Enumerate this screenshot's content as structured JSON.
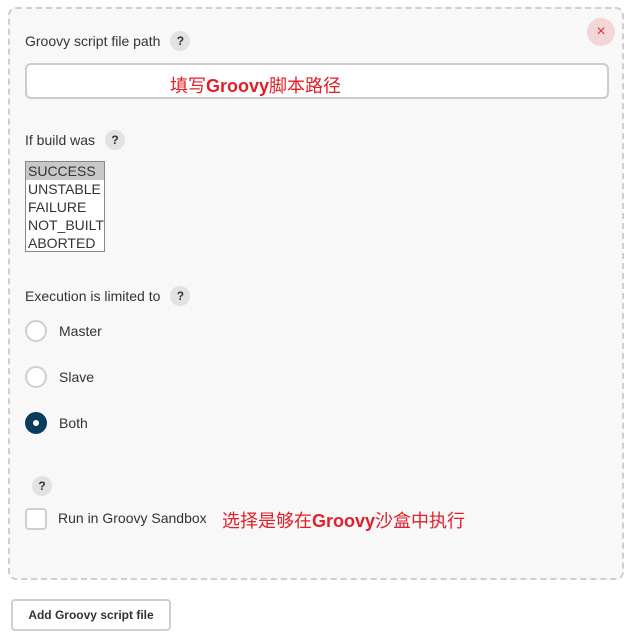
{
  "panel": {
    "close_glyph": "×",
    "script_path": {
      "label": "Groovy script file path",
      "help": "?",
      "value": "",
      "annotation_prefix": "填写",
      "annotation_bold": "Groovy",
      "annotation_suffix": "脚本路径"
    },
    "build_result": {
      "label": "If build was",
      "help": "?",
      "options": [
        "SUCCESS",
        "UNSTABLE",
        "FAILURE",
        "NOT_BUILT",
        "ABORTED"
      ],
      "selected": "SUCCESS"
    },
    "execution": {
      "label": "Execution is limited to",
      "help": "?",
      "options": [
        "Master",
        "Slave",
        "Both"
      ],
      "selected": "Both"
    },
    "sandbox": {
      "help": "?",
      "label": "Run in Groovy Sandbox",
      "checked": false,
      "annotation_prefix": "选择是够在",
      "annotation_bold": "Groovy",
      "annotation_suffix": "沙盒中执行"
    }
  },
  "add_button_label": "Add Groovy script file",
  "colors": {
    "accent": "#0b3c5d",
    "annotation": "#e0202a",
    "close": "#d33"
  }
}
